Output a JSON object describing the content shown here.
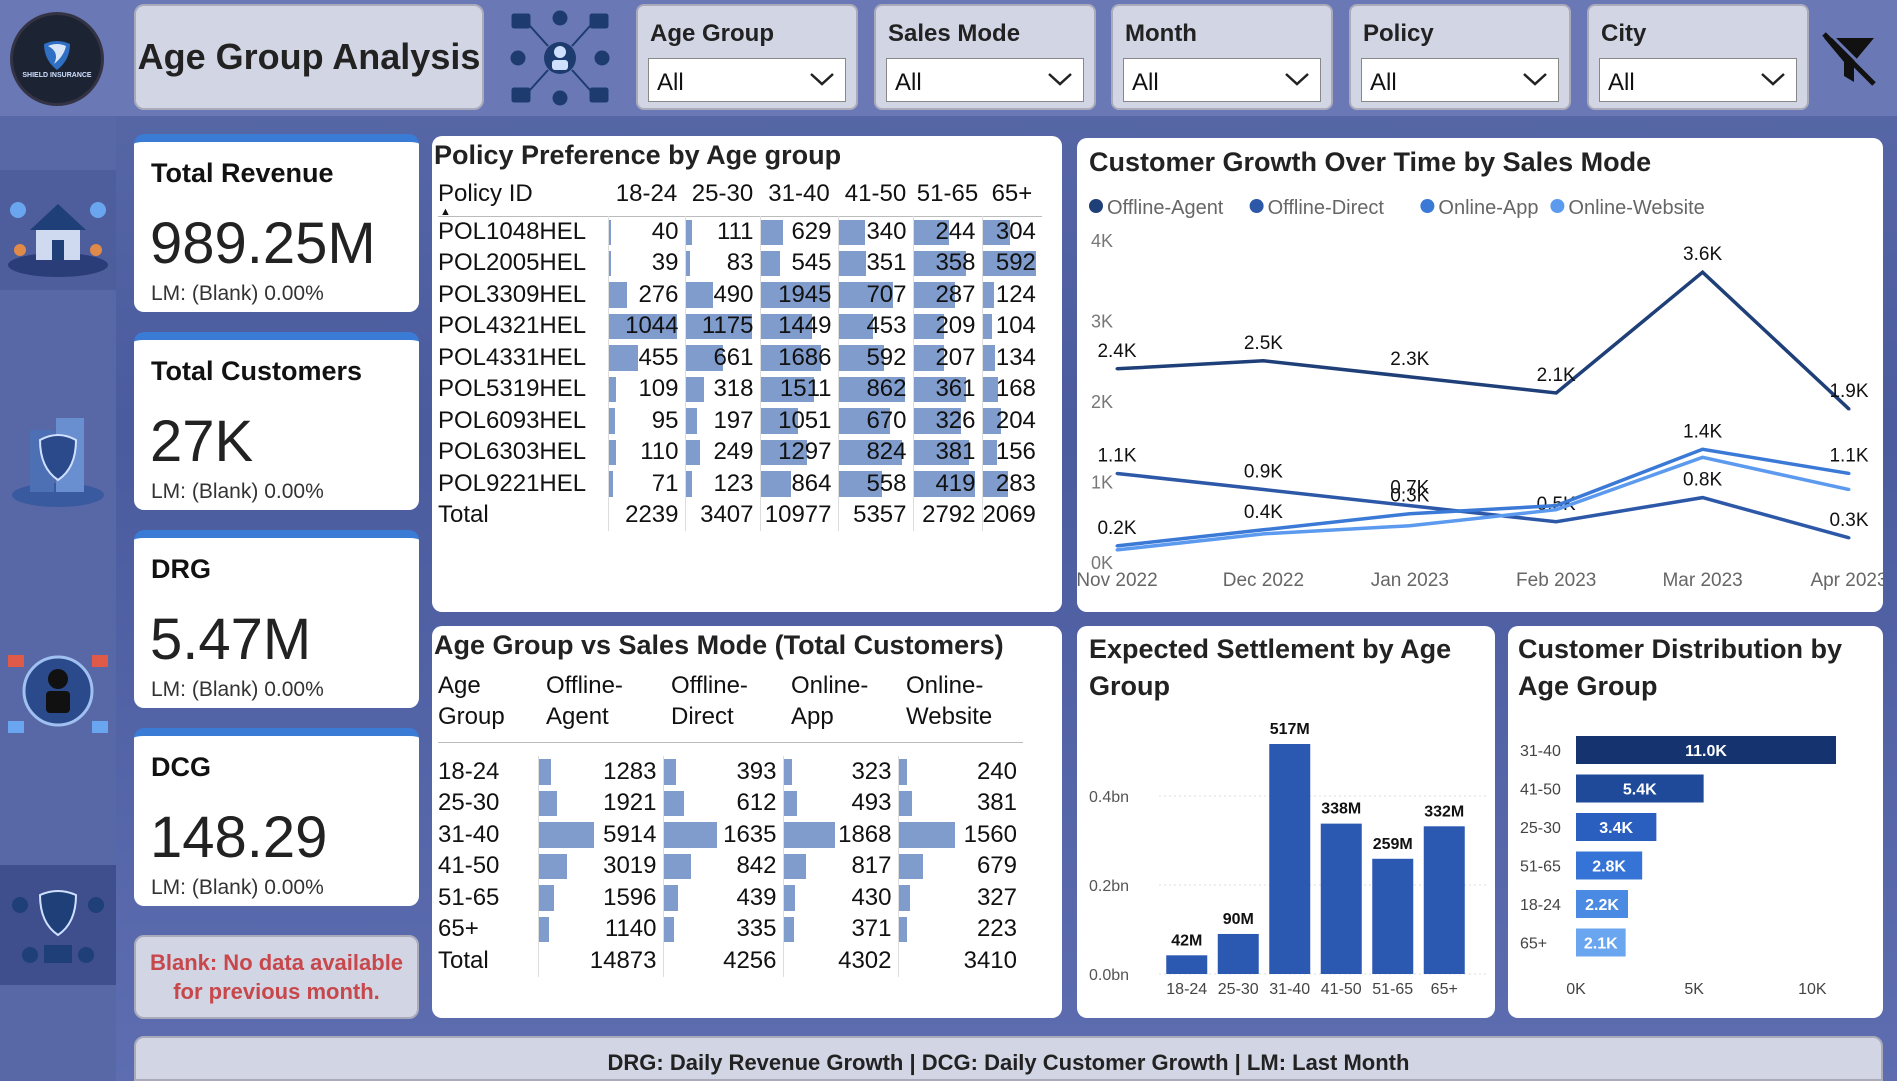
{
  "header": {
    "logo_text": "SHIELD INSURANCE",
    "title": "Age Group Analysis",
    "slicers": [
      {
        "label": "Age Group",
        "value": "All"
      },
      {
        "label": "Sales Mode",
        "value": "All"
      },
      {
        "label": "Month",
        "value": "All"
      },
      {
        "label": "Policy",
        "value": "All"
      },
      {
        "label": "City",
        "value": "All"
      }
    ],
    "clear_filter_icon": "filter-clear-icon"
  },
  "sidebar": {
    "icons": [
      "house-insurance-icon",
      "building-insurance-icon",
      "person-security-icon",
      "protection-network-icon"
    ]
  },
  "kpis": [
    {
      "title": "Total Revenue",
      "value": "989.25M",
      "lm": "LM: (Blank) 0.00%"
    },
    {
      "title": "Total Customers",
      "value": "27K",
      "lm": "LM: (Blank) 0.00%"
    },
    {
      "title": "DRG",
      "value": "5.47M",
      "lm": "LM: (Blank) 0.00%"
    },
    {
      "title": "DCG",
      "value": "148.29",
      "lm": "LM: (Blank) 0.00%"
    }
  ],
  "blank_note": {
    "line1": "Blank: No data available",
    "line2": "for previous month."
  },
  "policy_matrix": {
    "title": "Policy Preference by Age group",
    "columns": [
      "Policy ID",
      "18-24",
      "25-30",
      "31-40",
      "41-50",
      "51-65",
      "65+"
    ],
    "rows": [
      {
        "id": "POL1048HEL",
        "values": [
          40,
          111,
          629,
          340,
          244,
          304
        ]
      },
      {
        "id": "POL2005HEL",
        "values": [
          39,
          83,
          545,
          351,
          358,
          592
        ]
      },
      {
        "id": "POL3309HEL",
        "values": [
          276,
          490,
          1945,
          707,
          287,
          124
        ]
      },
      {
        "id": "POL4321HEL",
        "values": [
          1044,
          1175,
          1449,
          453,
          209,
          104
        ]
      },
      {
        "id": "POL4331HEL",
        "values": [
          455,
          661,
          1686,
          592,
          207,
          134
        ]
      },
      {
        "id": "POL5319HEL",
        "values": [
          109,
          318,
          1511,
          862,
          361,
          168
        ]
      },
      {
        "id": "POL6093HEL",
        "values": [
          95,
          197,
          1051,
          670,
          326,
          204
        ]
      },
      {
        "id": "POL6303HEL",
        "values": [
          110,
          249,
          1297,
          824,
          381,
          156
        ]
      },
      {
        "id": "POL9221HEL",
        "values": [
          71,
          123,
          864,
          558,
          419,
          283
        ]
      }
    ],
    "total": {
      "label": "Total",
      "values": [
        2239,
        3407,
        10977,
        5357,
        2792,
        2069
      ]
    }
  },
  "sales_matrix": {
    "title": "Age Group vs Sales Mode (Total Customers)",
    "columns": [
      [
        "Age",
        "Group"
      ],
      [
        "Offline-",
        "Agent"
      ],
      [
        "Offline-",
        "Direct"
      ],
      [
        "Online-",
        "App"
      ],
      [
        "Online-",
        "Website"
      ]
    ],
    "rows": [
      {
        "group": "18-24",
        "values": [
          1283,
          393,
          323,
          240
        ]
      },
      {
        "group": "25-30",
        "values": [
          1921,
          612,
          493,
          381
        ]
      },
      {
        "group": "31-40",
        "values": [
          5914,
          1635,
          1868,
          1560
        ]
      },
      {
        "group": "41-50",
        "values": [
          3019,
          842,
          817,
          679
        ]
      },
      {
        "group": "51-65",
        "values": [
          1596,
          439,
          430,
          327
        ]
      },
      {
        "group": "65+",
        "values": [
          1140,
          335,
          371,
          223
        ]
      }
    ],
    "total": {
      "label": "Total",
      "values": [
        14873,
        4256,
        4302,
        3410
      ]
    }
  },
  "chart_data": [
    {
      "type": "line",
      "title": "Customer Growth Over Time by Sales Mode",
      "x": [
        "Nov 2022",
        "Dec 2022",
        "Jan 2023",
        "Feb 2023",
        "Mar 2023",
        "Apr 2023"
      ],
      "ylim": [
        0,
        4000
      ],
      "yticks": [
        "0K",
        "1K",
        "2K",
        "3K",
        "4K"
      ],
      "legend_position": "top-left",
      "series": [
        {
          "name": "Offline-Agent",
          "color": "#1f3f78",
          "values": [
            2400,
            2500,
            2300,
            2100,
            3600,
            1900
          ],
          "labels": [
            "2.4K",
            "2.5K",
            "2.3K",
            "2.1K",
            "3.6K",
            "1.9K"
          ]
        },
        {
          "name": "Offline-Direct",
          "color": "#2d58a8",
          "values": [
            1100,
            900,
            700,
            500,
            800,
            300
          ],
          "labels": [
            "1.1K",
            "0.9K",
            "0.7K",
            "0.5K",
            "0.8K",
            "0.3K"
          ]
        },
        {
          "name": "Online-App",
          "color": "#3a79d6",
          "values": [
            200,
            400,
            600,
            700,
            1400,
            1100
          ],
          "labels": [
            "0.2K",
            "0.4K",
            "0.3K",
            "",
            "1.4K",
            "1.1K"
          ]
        },
        {
          "name": "Online-Website",
          "color": "#5b9aee",
          "values": [
            150,
            350,
            450,
            650,
            1300,
            900
          ],
          "labels": [
            "",
            "",
            "",
            "",
            "",
            ""
          ]
        }
      ]
    },
    {
      "type": "bar",
      "title": "Expected Settlement by Age Group",
      "categories": [
        "18-24",
        "25-30",
        "31-40",
        "41-50",
        "51-65",
        "65+"
      ],
      "values": [
        42,
        90,
        517,
        338,
        259,
        332
      ],
      "labels": [
        "42M",
        "90M",
        "517M",
        "338M",
        "259M",
        "332M"
      ],
      "yticks": [
        "0.0bn",
        "0.2bn",
        "0.4bn"
      ],
      "ylim": [
        0,
        517
      ],
      "color": "#2b58b0"
    },
    {
      "type": "bar",
      "orientation": "horizontal",
      "title": "Customer Distribution by Age Group",
      "categories": [
        "31-40",
        "41-50",
        "25-30",
        "51-65",
        "18-24",
        "65+"
      ],
      "values": [
        11000,
        5400,
        3400,
        2800,
        2200,
        2100
      ],
      "labels": [
        "11.0K",
        "5.4K",
        "3.4K",
        "2.8K",
        "2.2K",
        "2.1K"
      ],
      "colors": [
        "#15336e",
        "#1f4a9a",
        "#2b5fbf",
        "#3574d6",
        "#4a8ae2",
        "#6aa6ef"
      ],
      "xticks": [
        "0K",
        "5K",
        "10K"
      ],
      "xlim": [
        0,
        11000
      ]
    }
  ],
  "footer": {
    "text": "DRG: Daily Revenue Growth | DCG: Daily Customer Growth | LM: Last Month"
  }
}
